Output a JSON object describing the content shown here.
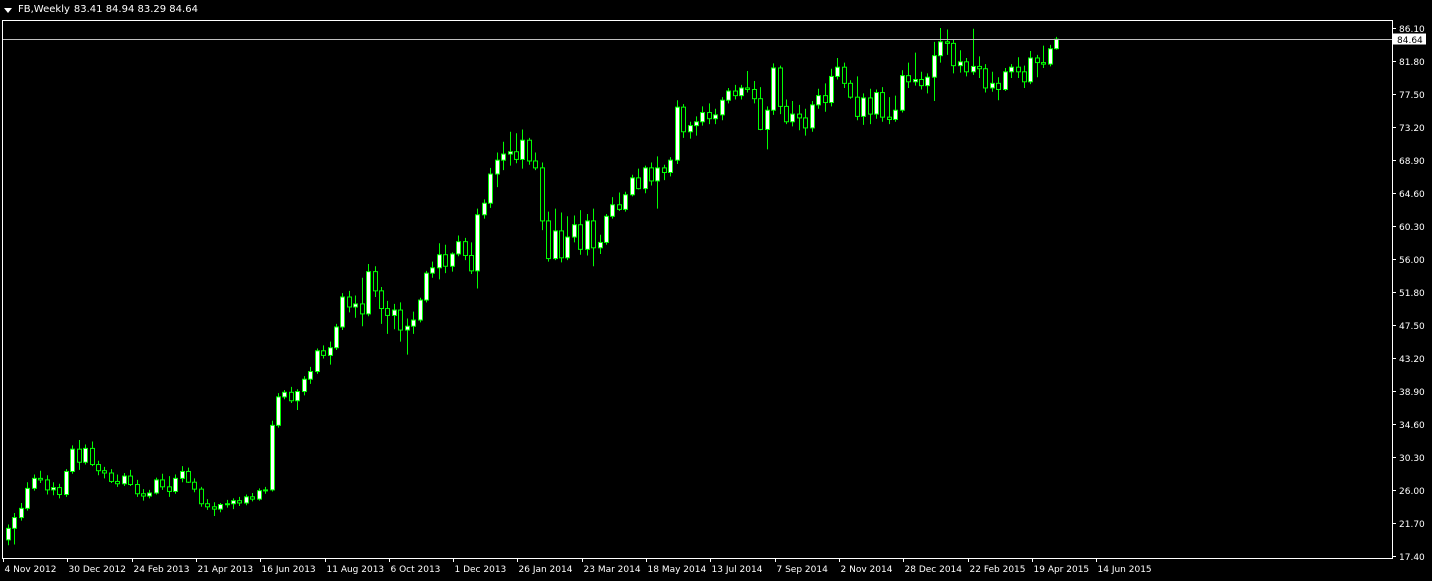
{
  "window": {
    "symbol": "FB,Weekly",
    "ohlc_readout": "83.41 84.94 83.29 84.64"
  },
  "colors": {
    "background": "#000000",
    "foreground": "#ffffff",
    "bull": "#00ff00",
    "bull_body": "#ffffff",
    "bear": "#00ff00",
    "bear_body": "#000000",
    "price_line": "#c0c0c0"
  },
  "chart_data": {
    "type": "candlestick",
    "title": "FB,Weekly",
    "ohlc": "83.41 84.94 83.29 84.64",
    "last_price": "84.64",
    "ylim": [
      17.4,
      86.1
    ],
    "y_ticks": [
      "86.10",
      "81.80",
      "77.50",
      "73.20",
      "68.90",
      "64.60",
      "60.30",
      "56.00",
      "51.80",
      "47.50",
      "43.20",
      "38.90",
      "34.60",
      "30.30",
      "26.00",
      "21.70",
      "17.40"
    ],
    "x_ticks": [
      "4 Nov 2012",
      "30 Dec 2012",
      "24 Feb 2013",
      "21 Apr 2013",
      "16 Jun 2013",
      "11 Aug 2013",
      "6 Oct 2013",
      "1 Dec 2013",
      "26 Jan 2014",
      "23 Mar 2014",
      "18 May 2014",
      "13 Jul 2014",
      "7 Sep 2014",
      "2 Nov 2014",
      "28 Dec 2014",
      "22 Feb 2015",
      "19 Apr 2015",
      "14 Jun 2015"
    ],
    "candles": [
      [
        19.5,
        21.5,
        18.8,
        21.0
      ],
      [
        21.0,
        23.0,
        18.9,
        22.4
      ],
      [
        22.4,
        24.3,
        22.0,
        23.6
      ],
      [
        23.6,
        27.0,
        23.3,
        26.2
      ],
      [
        26.2,
        28.0,
        25.9,
        27.5
      ],
      [
        27.5,
        28.5,
        26.9,
        27.3
      ],
      [
        27.3,
        27.9,
        25.4,
        26.0
      ],
      [
        26.0,
        27.0,
        25.3,
        26.3
      ],
      [
        26.3,
        26.8,
        24.9,
        25.4
      ],
      [
        25.4,
        28.7,
        25.1,
        28.4
      ],
      [
        28.4,
        31.8,
        28.1,
        31.3
      ],
      [
        31.3,
        32.5,
        28.6,
        29.6
      ],
      [
        29.6,
        31.9,
        29.3,
        31.4
      ],
      [
        31.4,
        32.3,
        29.1,
        29.3
      ],
      [
        29.3,
        29.8,
        27.9,
        28.5
      ],
      [
        28.5,
        29.0,
        27.5,
        28.2
      ],
      [
        28.2,
        28.7,
        26.9,
        27.1
      ],
      [
        27.1,
        28.0,
        26.4,
        26.8
      ],
      [
        26.8,
        28.2,
        26.5,
        27.8
      ],
      [
        27.8,
        28.6,
        26.5,
        26.7
      ],
      [
        26.7,
        27.3,
        25.1,
        25.5
      ],
      [
        25.5,
        26.1,
        24.6,
        25.2
      ],
      [
        25.2,
        26.0,
        24.9,
        25.6
      ],
      [
        25.6,
        27.6,
        25.4,
        27.3
      ],
      [
        27.3,
        28.1,
        26.0,
        26.4
      ],
      [
        26.4,
        27.8,
        25.1,
        25.8
      ],
      [
        25.8,
        28.0,
        25.5,
        27.5
      ],
      [
        27.5,
        29.1,
        27.0,
        28.4
      ],
      [
        28.4,
        28.9,
        26.9,
        27.0
      ],
      [
        27.0,
        27.5,
        25.7,
        26.1
      ],
      [
        26.1,
        26.4,
        23.8,
        24.2
      ],
      [
        24.2,
        24.8,
        23.4,
        23.8
      ],
      [
        23.8,
        24.4,
        22.6,
        23.5
      ],
      [
        23.5,
        24.3,
        23.1,
        24.1
      ],
      [
        24.1,
        24.7,
        23.7,
        24.2
      ],
      [
        24.2,
        24.9,
        23.5,
        24.6
      ],
      [
        24.6,
        25.1,
        23.9,
        24.3
      ],
      [
        24.3,
        25.4,
        24.0,
        25.1
      ],
      [
        25.1,
        25.6,
        24.5,
        24.8
      ],
      [
        24.8,
        26.2,
        24.6,
        25.9
      ],
      [
        25.9,
        26.4,
        25.5,
        26.0
      ],
      [
        26.0,
        35.0,
        25.8,
        34.4
      ],
      [
        34.4,
        38.6,
        34.1,
        38.1
      ],
      [
        38.1,
        39.0,
        37.8,
        38.7
      ],
      [
        38.7,
        39.4,
        37.3,
        37.6
      ],
      [
        37.6,
        39.1,
        36.4,
        38.8
      ],
      [
        38.8,
        40.8,
        38.3,
        40.4
      ],
      [
        40.4,
        42.0,
        39.8,
        41.4
      ],
      [
        41.4,
        44.4,
        41.1,
        44.1
      ],
      [
        44.1,
        44.8,
        43.1,
        43.5
      ],
      [
        43.5,
        45.3,
        42.3,
        44.5
      ],
      [
        44.5,
        47.6,
        44.2,
        47.2
      ],
      [
        47.2,
        51.6,
        46.8,
        51.1
      ],
      [
        51.1,
        51.9,
        49.1,
        49.8
      ],
      [
        49.8,
        51.3,
        48.4,
        50.2
      ],
      [
        50.2,
        53.6,
        47.3,
        48.9
      ],
      [
        48.9,
        55.4,
        48.6,
        54.4
      ],
      [
        54.4,
        55.1,
        51.1,
        51.9
      ],
      [
        51.9,
        52.4,
        47.6,
        49.6
      ],
      [
        49.6,
        50.6,
        46.3,
        48.7
      ],
      [
        48.7,
        50.2,
        46.9,
        49.4
      ],
      [
        49.4,
        50.4,
        45.3,
        46.8
      ],
      [
        46.8,
        48.3,
        43.6,
        47.3
      ],
      [
        47.3,
        49.2,
        46.3,
        48.1
      ],
      [
        48.1,
        51.0,
        47.8,
        50.7
      ],
      [
        50.7,
        54.5,
        50.4,
        54.2
      ],
      [
        54.2,
        55.7,
        53.6,
        54.9
      ],
      [
        54.9,
        58.1,
        53.4,
        56.6
      ],
      [
        56.6,
        57.9,
        54.2,
        55.1
      ],
      [
        55.1,
        56.9,
        54.4,
        56.7
      ],
      [
        56.7,
        59.1,
        56.4,
        58.3
      ],
      [
        58.3,
        58.8,
        55.9,
        56.5
      ],
      [
        56.5,
        58.2,
        54.1,
        54.5
      ],
      [
        54.5,
        62.6,
        52.2,
        61.8
      ],
      [
        61.8,
        63.8,
        61.3,
        63.3
      ],
      [
        63.3,
        67.9,
        62.7,
        67.1
      ],
      [
        67.1,
        69.9,
        65.4,
        68.9
      ],
      [
        68.9,
        71.3,
        67.6,
        69.7
      ],
      [
        69.7,
        72.6,
        68.2,
        70.0
      ],
      [
        70.0,
        72.4,
        68.5,
        69.0
      ],
      [
        69.0,
        72.9,
        67.8,
        71.5
      ],
      [
        71.5,
        71.8,
        68.3,
        68.8
      ],
      [
        68.8,
        69.9,
        67.6,
        67.9
      ],
      [
        67.9,
        68.6,
        59.8,
        61.0
      ],
      [
        61.0,
        62.2,
        55.7,
        56.1
      ],
      [
        56.1,
        62.6,
        55.9,
        59.7
      ],
      [
        59.7,
        62.1,
        55.6,
        56.2
      ],
      [
        56.2,
        61.6,
        55.9,
        58.9
      ],
      [
        58.9,
        61.7,
        58.2,
        60.5
      ],
      [
        60.5,
        62.4,
        56.6,
        57.3
      ],
      [
        57.3,
        61.9,
        56.5,
        61.0
      ],
      [
        61.0,
        62.6,
        55.1,
        57.5
      ],
      [
        57.5,
        59.2,
        56.7,
        58.2
      ],
      [
        58.2,
        61.9,
        57.9,
        61.6
      ],
      [
        61.6,
        64.1,
        61.3,
        63.1
      ],
      [
        63.1,
        64.7,
        62.3,
        62.5
      ],
      [
        62.5,
        64.8,
        62.2,
        64.4
      ],
      [
        64.4,
        67.0,
        64.2,
        66.6
      ],
      [
        66.6,
        67.8,
        65.1,
        65.2
      ],
      [
        65.2,
        68.2,
        64.6,
        67.9
      ],
      [
        67.9,
        68.6,
        65.6,
        66.2
      ],
      [
        66.2,
        69.4,
        62.6,
        67.9
      ],
      [
        67.9,
        68.3,
        66.3,
        67.3
      ],
      [
        67.3,
        69.3,
        66.8,
        68.9
      ],
      [
        68.9,
        76.7,
        68.4,
        75.8
      ],
      [
        75.8,
        76.2,
        71.8,
        72.6
      ],
      [
        72.6,
        73.9,
        71.7,
        73.4
      ],
      [
        73.4,
        74.6,
        72.1,
        73.9
      ],
      [
        73.9,
        75.9,
        73.4,
        75.1
      ],
      [
        75.1,
        76.3,
        73.6,
        74.3
      ],
      [
        74.3,
        75.6,
        73.6,
        74.8
      ],
      [
        74.8,
        77.1,
        74.1,
        76.7
      ],
      [
        76.7,
        78.3,
        76.3,
        77.9
      ],
      [
        77.9,
        78.7,
        76.8,
        77.3
      ],
      [
        77.3,
        78.7,
        76.8,
        78.3
      ],
      [
        78.3,
        80.5,
        77.7,
        78.1
      ],
      [
        78.1,
        79.2,
        76.3,
        76.9
      ],
      [
        76.9,
        78.4,
        72.8,
        72.9
      ],
      [
        72.9,
        75.9,
        70.3,
        75.4
      ],
      [
        75.4,
        81.5,
        74.8,
        80.9
      ],
      [
        80.9,
        81.2,
        74.9,
        75.9
      ],
      [
        75.9,
        76.8,
        73.6,
        73.9
      ],
      [
        73.9,
        76.6,
        73.3,
        74.9
      ],
      [
        74.9,
        76.1,
        72.8,
        74.4
      ],
      [
        74.4,
        75.6,
        72.1,
        73.1
      ],
      [
        73.1,
        76.6,
        72.6,
        76.1
      ],
      [
        76.1,
        78.2,
        75.6,
        77.3
      ],
      [
        77.3,
        78.9,
        75.2,
        76.4
      ],
      [
        76.4,
        80.8,
        75.9,
        79.8
      ],
      [
        79.8,
        82.2,
        79.4,
        81.0
      ],
      [
        81.0,
        81.6,
        78.3,
        78.9
      ],
      [
        78.9,
        79.3,
        76.9,
        77.1
      ],
      [
        77.1,
        79.8,
        74.1,
        74.6
      ],
      [
        74.6,
        77.6,
        73.5,
        77.0
      ],
      [
        77.0,
        78.2,
        73.6,
        74.9
      ],
      [
        74.9,
        78.1,
        74.3,
        77.7
      ],
      [
        77.7,
        78.4,
        73.9,
        74.5
      ],
      [
        74.5,
        77.1,
        73.6,
        74.2
      ],
      [
        74.2,
        77.3,
        73.9,
        75.4
      ],
      [
        75.4,
        80.6,
        75.1,
        79.9
      ],
      [
        79.9,
        81.6,
        78.3,
        79.1
      ],
      [
        79.1,
        82.9,
        78.6,
        79.4
      ],
      [
        79.4,
        80.4,
        78.1,
        78.6
      ],
      [
        78.6,
        80.2,
        77.6,
        79.7
      ],
      [
        79.7,
        84.3,
        76.6,
        82.5
      ],
      [
        82.5,
        86.1,
        81.6,
        84.3
      ],
      [
        84.3,
        85.9,
        82.6,
        84.1
      ],
      [
        84.1,
        84.6,
        80.2,
        81.2
      ],
      [
        81.2,
        83.2,
        80.3,
        81.7
      ],
      [
        81.7,
        82.2,
        79.8,
        80.4
      ],
      [
        80.4,
        86.0,
        80.0,
        81.1
      ],
      [
        81.1,
        82.4,
        79.6,
        80.8
      ],
      [
        80.8,
        81.4,
        77.7,
        78.3
      ],
      [
        78.3,
        80.4,
        77.8,
        78.9
      ],
      [
        78.9,
        79.7,
        76.7,
        78.1
      ],
      [
        78.1,
        80.9,
        77.9,
        80.4
      ],
      [
        80.4,
        81.4,
        79.6,
        81.0
      ],
      [
        81.0,
        82.3,
        79.6,
        80.4
      ],
      [
        80.4,
        81.2,
        78.3,
        79.1
      ],
      [
        79.1,
        83.1,
        78.8,
        82.2
      ],
      [
        82.2,
        82.6,
        79.7,
        81.6
      ],
      [
        81.6,
        83.8,
        80.9,
        81.4
      ],
      [
        81.4,
        83.9,
        81.1,
        83.4
      ],
      [
        83.41,
        84.94,
        83.29,
        84.64
      ]
    ]
  }
}
